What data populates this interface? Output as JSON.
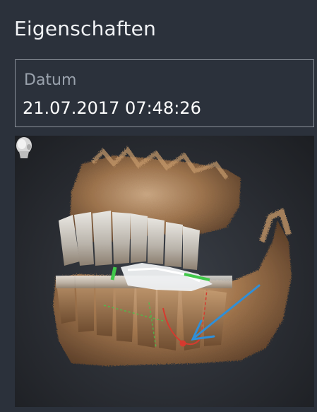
{
  "panel": {
    "title": "Eigenschaften"
  },
  "date_field": {
    "label": "Datum",
    "value": "21.07.2017 07:48:26"
  },
  "viewport": {
    "orientation_icon": "head-orientation-icon",
    "content": "3d-jaw-volume-rendering",
    "colors": {
      "bone": "#b58a5e",
      "nerve_canal": "#d63a2f",
      "implant_guide": "#41c84a",
      "arrow": "#2f8fd8",
      "background": "#2a2d33"
    }
  }
}
